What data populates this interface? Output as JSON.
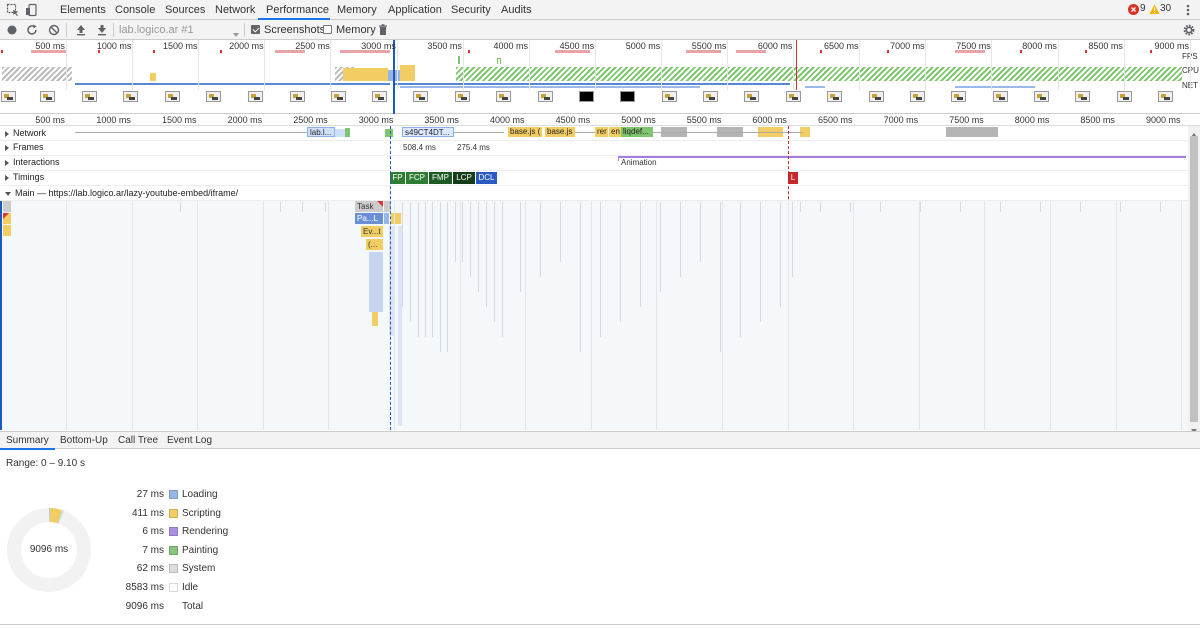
{
  "tabs": [
    {
      "label": "Elements"
    },
    {
      "label": "Console"
    },
    {
      "label": "Sources"
    },
    {
      "label": "Network"
    },
    {
      "label": "Performance"
    },
    {
      "label": "Memory"
    },
    {
      "label": "Application"
    },
    {
      "label": "Security"
    },
    {
      "label": "Audits"
    }
  ],
  "status": {
    "errors": "9",
    "warnings": "30"
  },
  "toolbar": {
    "profile_select": "lab.logico.ar #1",
    "screenshots_label": "Screenshots",
    "memory_label": "Memory"
  },
  "overview": {
    "ticks": [
      "500 ms",
      "1000 ms",
      "1500 ms",
      "2000 ms",
      "2500 ms",
      "3000 ms",
      "3500 ms",
      "4000 ms",
      "4500 ms",
      "5000 ms",
      "5500 ms",
      "6000 ms",
      "6500 ms",
      "7000 ms",
      "7500 ms",
      "8000 ms",
      "8500 ms",
      "9000 ms"
    ],
    "fps_label": "FPS",
    "cpu_label": "CPU",
    "net_label": "NET"
  },
  "ruler": {
    "ticks": [
      "500 ms",
      "1000 ms",
      "1500 ms",
      "2000 ms",
      "2500 ms",
      "3000 ms",
      "3500 ms",
      "4000 ms",
      "4500 ms",
      "5000 ms",
      "5500 ms",
      "6000 ms",
      "6500 ms",
      "7000 ms",
      "7500 ms",
      "8000 ms",
      "8500 ms",
      "9000 ms"
    ]
  },
  "tracks": {
    "network": "Network",
    "frames": "Frames",
    "interactions": "Interactions",
    "timings": "Timings",
    "main": "Main — https://lab.logico.ar/lazy-youtube-embed/iframe/"
  },
  "network_bars": [
    {
      "label": "lab.l..."
    },
    {
      "label": "s49CT4DT..."
    },
    {
      "label": "base.js ("
    },
    {
      "label": "base.js"
    },
    {
      "label": "rer"
    },
    {
      "label": "en"
    },
    {
      "label": "liqdef..."
    }
  ],
  "frames": {
    "f1": "508.4 ms",
    "f2": "275.4 ms"
  },
  "interactions": {
    "animation": "Animation"
  },
  "timings": [
    {
      "label": "FP"
    },
    {
      "label": "FCP"
    },
    {
      "label": "FMP"
    },
    {
      "label": "LCP"
    },
    {
      "label": "DCL"
    },
    {
      "label": "L"
    }
  ],
  "flame": {
    "task": "Task",
    "parse": "Pa...L",
    "event": "Ev...t",
    "call": "(..."
  },
  "subtabs": [
    {
      "label": "Summary"
    },
    {
      "label": "Bottom-Up"
    },
    {
      "label": "Call Tree"
    },
    {
      "label": "Event Log"
    }
  ],
  "summary": {
    "range": "Range: 0 – 9.10 s",
    "donut_total": "9096 ms",
    "rows": [
      {
        "value": "27 ms",
        "name": "Loading",
        "color": "#96b6e6"
      },
      {
        "value": "411 ms",
        "name": "Scripting",
        "color": "#f2cd64"
      },
      {
        "value": "6 ms",
        "name": "Rendering",
        "color": "#ad8fe0"
      },
      {
        "value": "7 ms",
        "name": "Painting",
        "color": "#88c47d"
      },
      {
        "value": "62 ms",
        "name": "System",
        "color": "#dcdcdc"
      },
      {
        "value": "8583 ms",
        "name": "Idle",
        "color": "#ffffff"
      },
      {
        "value": "9096 ms",
        "name": "Total",
        "color": ""
      }
    ]
  }
}
